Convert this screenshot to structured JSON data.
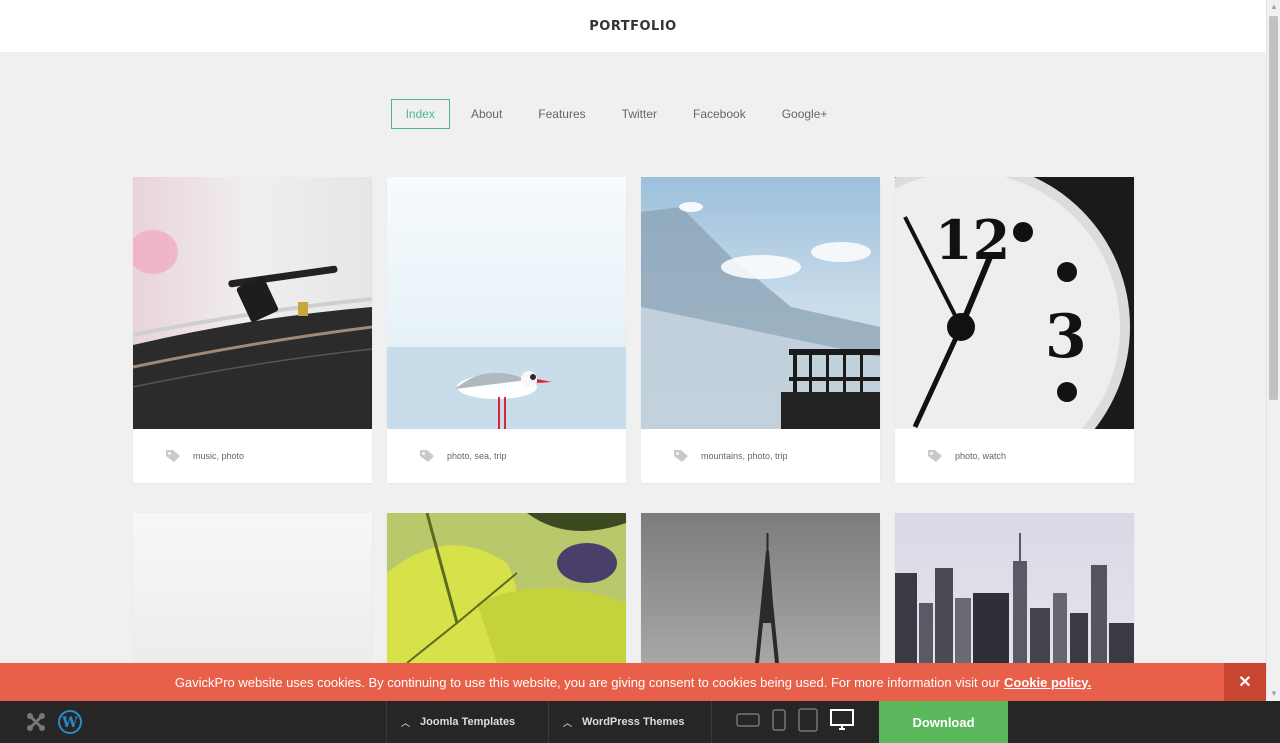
{
  "header": {
    "title": "PORTFOLIO"
  },
  "nav": {
    "tabs": [
      {
        "label": "Index",
        "active": true
      },
      {
        "label": "About",
        "active": false
      },
      {
        "label": "Features",
        "active": false
      },
      {
        "label": "Twitter",
        "active": false
      },
      {
        "label": "Facebook",
        "active": false
      },
      {
        "label": "Google+",
        "active": false
      }
    ]
  },
  "portfolio": {
    "items": [
      {
        "tags": "music, photo",
        "image": "turntable"
      },
      {
        "tags": "photo, sea, trip",
        "image": "seagull"
      },
      {
        "tags": "mountains, photo, trip",
        "image": "mountains"
      },
      {
        "tags": "photo, watch",
        "image": "clock"
      },
      {
        "tags": "",
        "image": "fog"
      },
      {
        "tags": "",
        "image": "leaves"
      },
      {
        "tags": "",
        "image": "eiffel-tower"
      },
      {
        "tags": "",
        "image": "city-skyline"
      }
    ]
  },
  "cookie": {
    "message": "GavickPro website uses cookies. By continuing to use this website, you are giving consent to cookies being used. For more information visit our",
    "link_label": "Cookie policy.",
    "close_label": "✕"
  },
  "bottom_bar": {
    "joomla_label": "Joomla Templates",
    "wordpress_label": "WordPress Themes",
    "download_label": "Download"
  },
  "colors": {
    "accent": "#4cb68c",
    "cookie_bar": "#e9604a",
    "download": "#5cb85c",
    "bottom_bar": "#262626"
  }
}
